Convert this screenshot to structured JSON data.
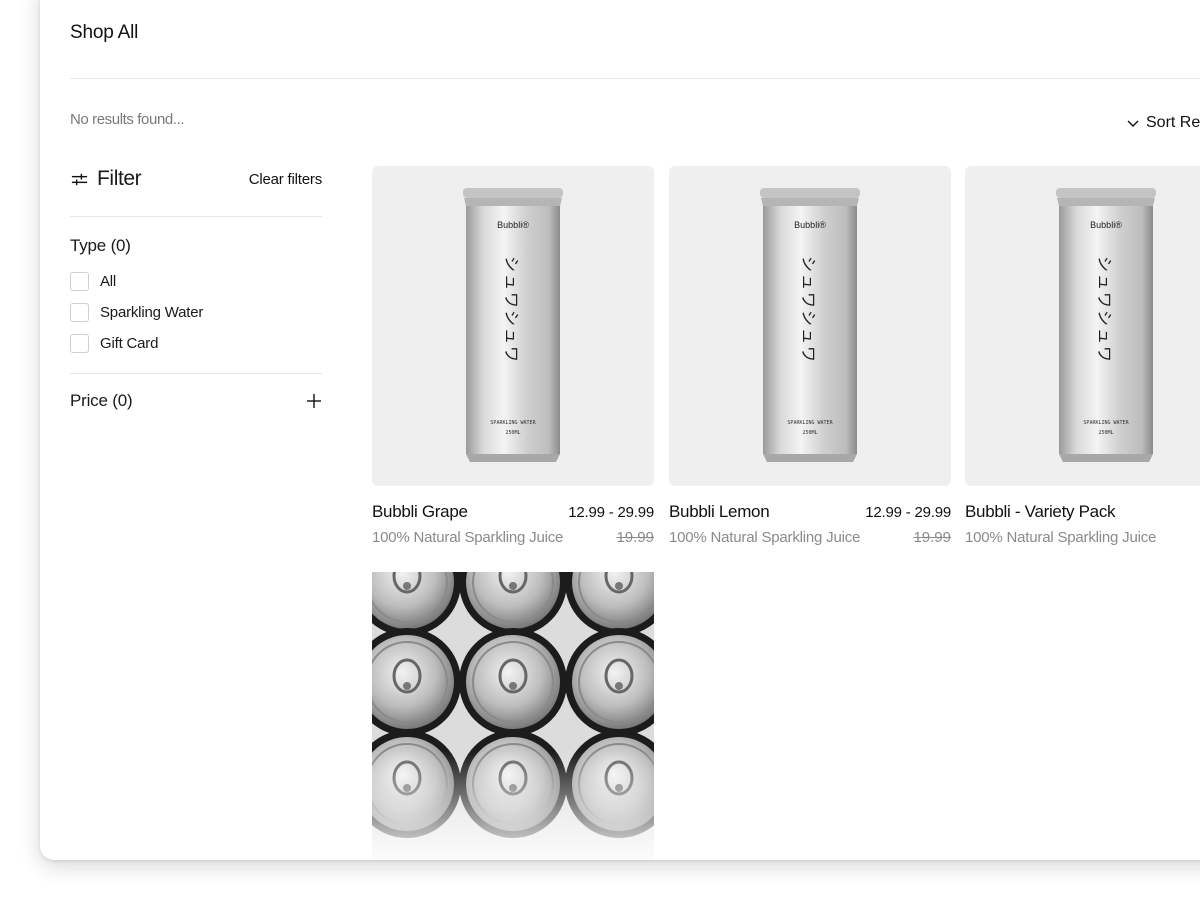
{
  "page": {
    "title": "Shop All"
  },
  "results": {
    "text": "No results found..."
  },
  "sort": {
    "label": "Sort Relevance",
    "icon": "chevron-down-icon"
  },
  "filter": {
    "title": "Filter",
    "icon": "sliders-icon",
    "clear_label": "Clear filters",
    "type_group": {
      "title": "Type (0)",
      "options": [
        "All",
        "Sparkling Water",
        "Gift Card"
      ]
    },
    "price_group": {
      "title": "Price (0)",
      "icon": "plus-icon"
    }
  },
  "can_art": {
    "brand": "Bubbli®",
    "vertical_text": "シュワシュワ",
    "line1": "SPARKLING WATER",
    "line2": "250ML"
  },
  "products": [
    {
      "name": "Bubbli Grape",
      "price": "12.99 - 29.99",
      "subtitle": "100% Natural Sparkling Juice",
      "old_price": "19.99"
    },
    {
      "name": "Bubbli Lemon",
      "price": "12.99 - 29.99",
      "subtitle": "100% Natural Sparkling Juice",
      "old_price": "19.99"
    },
    {
      "name": "Bubbli - Variety Pack",
      "price": "",
      "subtitle": "100% Natural Sparkling Juice",
      "old_price": ""
    }
  ]
}
